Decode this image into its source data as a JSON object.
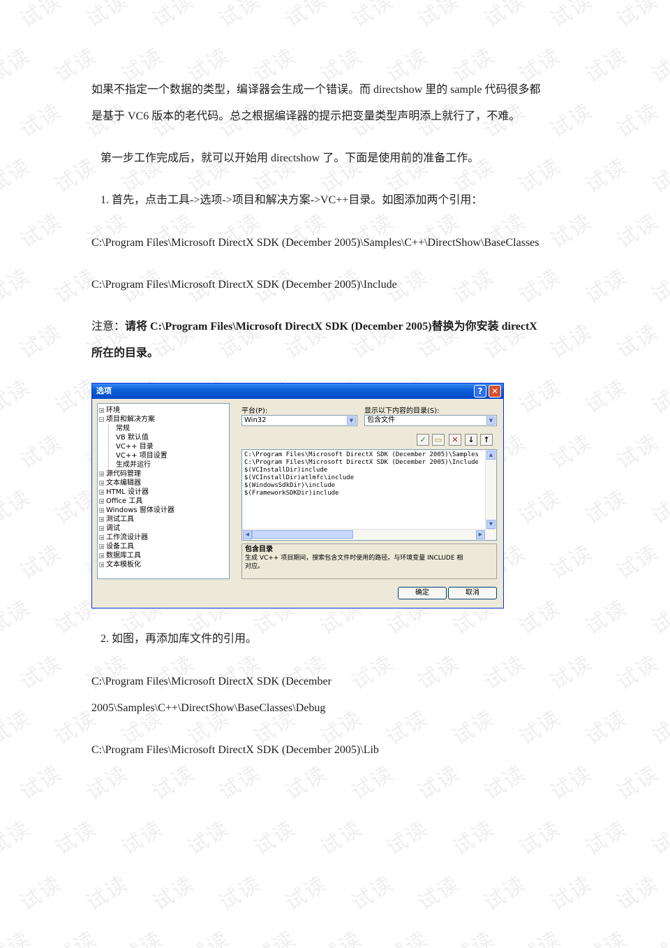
{
  "watermark": "试读",
  "paragraphs": {
    "p1_line1": "如果不指定一个数据的类型，编译器会生成一个错误。而 directshow 里的 sample 代码很多都",
    "p1_line2": "是基于 VC6 版本的老代码。总之根据编译器的提示把变量类型声明添上就行了，不难。",
    "p2": "第一步工作完成后，就可以开始用 directshow 了。下面是使用前的准备工作。",
    "step1": "1. 首先，点击工具->选项->项目和解决方案->VC++目录。如图添加两个引用：",
    "path1": "C:\\Program Files\\Microsoft DirectX SDK (December 2005)\\Samples\\C++\\DirectShow\\BaseClasses",
    "path2": "C:\\Program Files\\Microsoft DirectX SDK (December 2005)\\Include",
    "note_prefix": "注意：",
    "note_bold_line1": "请将 C:\\Program Files\\Microsoft DirectX SDK (December 2005)替换为你安装 directX",
    "note_bold_line2": "所在的目录。",
    "step2": "2. 如图，再添加库文件的引用。",
    "path3_line1": "C:\\Program Files\\Microsoft DirectX SDK (December",
    "path3_line2": "2005\\Samples\\C++\\DirectShow\\BaseClasses\\Debug",
    "path4": "C:\\Program Files\\Microsoft DirectX SDK (December 2005)\\Lib"
  },
  "dialog": {
    "title": "选项",
    "help_label": "?",
    "close_label": "✕",
    "tree": [
      {
        "label": "环境",
        "expander": "+"
      },
      {
        "label": "项目和解决方案",
        "expander": "−"
      },
      {
        "label": "常规",
        "child": true
      },
      {
        "label": "VB 默认值",
        "child": true
      },
      {
        "label": "VC++ 目录",
        "child": true
      },
      {
        "label": "VC++ 项目设置",
        "child": true
      },
      {
        "label": "生成并运行",
        "child": true
      },
      {
        "label": "源代码管理",
        "expander": "+"
      },
      {
        "label": "文本编辑器",
        "expander": "+"
      },
      {
        "label": "HTML 设计器",
        "expander": "+"
      },
      {
        "label": "Office 工具",
        "expander": "+"
      },
      {
        "label": "Windows 窗体设计器",
        "expander": "+"
      },
      {
        "label": "测试工具",
        "expander": "+"
      },
      {
        "label": "调试",
        "expander": "+"
      },
      {
        "label": "工作流设计器",
        "expander": "+"
      },
      {
        "label": "设备工具",
        "expander": "+"
      },
      {
        "label": "数据库工具",
        "expander": "+"
      },
      {
        "label": "文本模板化",
        "expander": "+"
      }
    ],
    "platform_label": "平台(P):",
    "platform_value": "Win32",
    "show_dirs_label": "显示以下内容的目录(S):",
    "show_dirs_value": "包含文件",
    "toolbar_icons": [
      "✓",
      "▭",
      "✕",
      "↓",
      "↑"
    ],
    "directories": [
      "C:\\Program Files\\Microsoft DirectX SDK (December 2005)\\Samples",
      "C:\\Program Files\\Microsoft DirectX SDK (December 2005)\\Include",
      "$(VCInstallDir)include",
      "$(VCInstallDir)atlmfc\\include",
      "$(WindowsSdkDir)\\include",
      "$(FrameworkSDKDir)include"
    ],
    "desc_title": "包含目录",
    "desc_text": "生成 VC++ 项目期间，搜索包含文件时使用的路径。与环境变量 INCLUDE 相对应。",
    "ok_label": "确定",
    "cancel_label": "取消"
  }
}
